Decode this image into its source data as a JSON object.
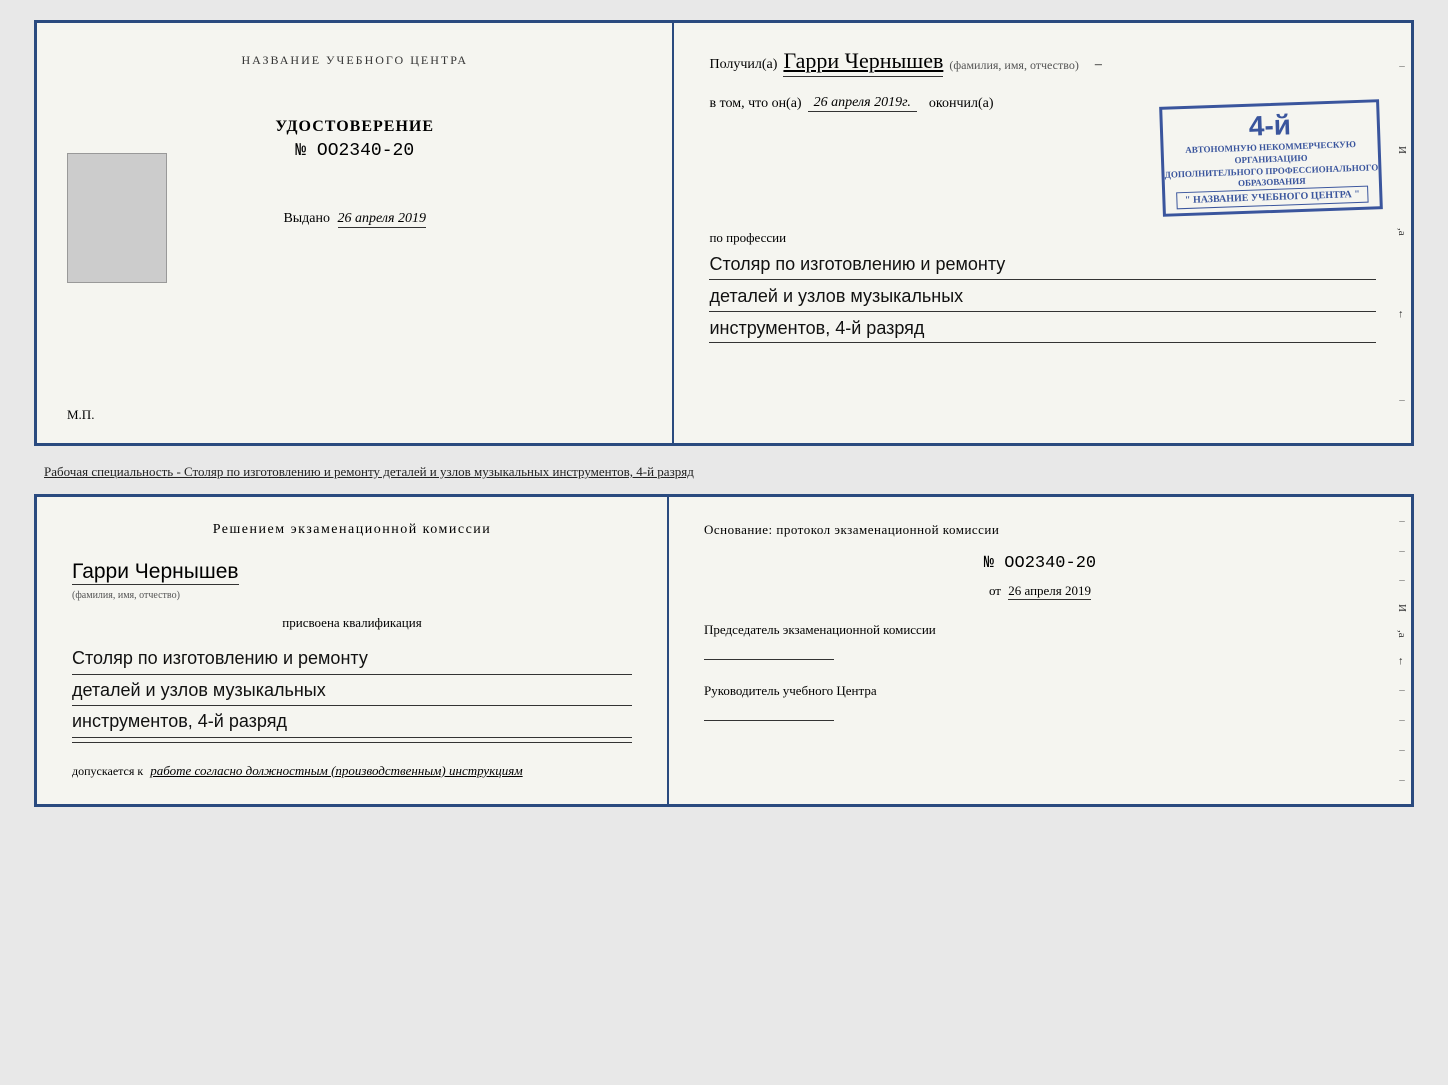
{
  "page": {
    "background_color": "#e8e8e8"
  },
  "top_document": {
    "left_page": {
      "header": "НАЗВАНИЕ УЧЕБНОГО ЦЕНТРА",
      "certificate_title": "УДОСТОВЕРЕНИЕ",
      "certificate_number": "№ OO2340-20",
      "vydano_label": "Выдано",
      "vydano_date": "26 апреля 2019",
      "mp_label": "М.П."
    },
    "right_page": {
      "recipient_label": "Получил(а)",
      "recipient_name": "Гарри Чернышев",
      "recipient_subtext": "(фамилия, имя, отчество)",
      "vtom_prefix": "в том, что он(а)",
      "vtom_date": "26 апреля 2019г.",
      "okончил_label": "окончил(а)",
      "org_line1": "АВТОНОМНУЮ НЕКОММЕРЧЕСКУЮ ОРГАНИЗАЦИЮ",
      "org_line2": "ДОПОЛНИТЕЛЬНОГО ПРОФЕССИОНАЛЬНОГО ОБРАЗОВАНИЯ",
      "org_name": "\" НАЗВАНИЕ УЧЕБНОГО ЦЕНТРА \"",
      "profession_label": "по профессии",
      "profession_line1": "Столяр по изготовлению и ремонту",
      "profession_line2": "деталей и узлов музыкальных",
      "profession_line3": "инструментов, 4-й разряд",
      "side_chars": [
        "–",
        "И",
        ",а",
        "←",
        "–"
      ]
    }
  },
  "middle_text": "Рабочая специальность - Столяр по изготовлению и ремонту деталей и узлов музыкальных инструментов, 4-й разряд",
  "bottom_document": {
    "left_page": {
      "decision_title": "Решением  экзаменационной  комиссии",
      "person_name": "Гарри Чернышев",
      "person_subtext": "(фамилия, имя, отчество)",
      "assigned_label": "присвоена квалификация",
      "qualification_line1": "Столяр по изготовлению и ремонту",
      "qualification_line2": "деталей и узлов музыкальных",
      "qualification_line3": "инструментов, 4-й разряд",
      "dopuskaetsya_prefix": "допускается к",
      "dopuskaetsya_text": "работе согласно должностным (производственным) инструкциям"
    },
    "right_page": {
      "osnovaniye_label": "Основание: протокол экзаменационной  комиссии",
      "protocol_number": "№  OO2340-20",
      "from_prefix": "от",
      "from_date": "26 апреля 2019",
      "chairman_title": "Председатель экзаменационной комиссии",
      "head_title": "Руководитель учебного Центра",
      "side_chars": [
        "–",
        "–",
        "–",
        "И",
        ",а",
        "←",
        "–",
        "–",
        "–",
        "–"
      ]
    }
  }
}
